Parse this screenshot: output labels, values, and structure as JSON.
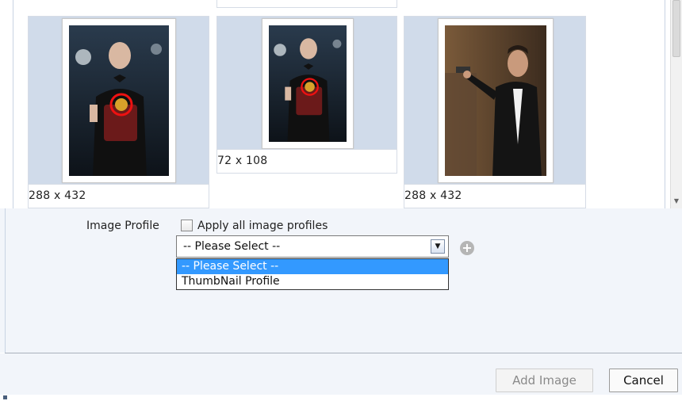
{
  "gallery": {
    "images": [
      {
        "size_label": "288 x 432"
      },
      {
        "size_label": "72 x 108"
      },
      {
        "size_label": "288 x 432"
      }
    ]
  },
  "image_profile": {
    "label": "Image Profile",
    "apply_all_label": "Apply all image profiles",
    "apply_all_checked": false,
    "select_value": "-- Please Select --",
    "options": [
      "-- Please Select --",
      "ThumbNail Profile"
    ],
    "highlighted_option": "-- Please Select --"
  },
  "footer": {
    "add_image_label": "Add Image",
    "cancel_label": "Cancel"
  },
  "colors": {
    "highlight": "#3399ff",
    "card_background": "#d0dbea",
    "panel_background": "#f2f5fa"
  }
}
